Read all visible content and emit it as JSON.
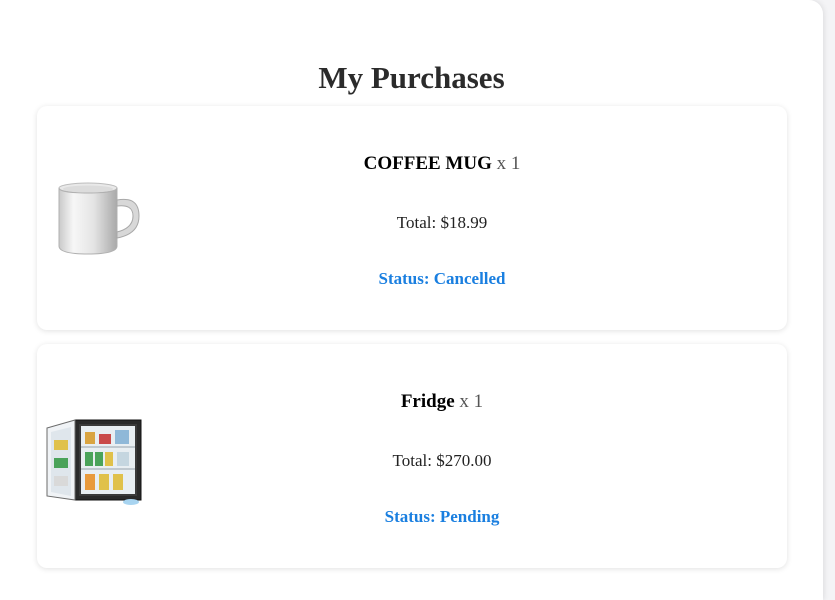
{
  "page": {
    "title": "My Purchases"
  },
  "purchases": [
    {
      "name": "COFFEE MUG",
      "qty": "x 1",
      "total": "Total: $18.99",
      "status": "Status: Cancelled",
      "image_icon": "coffee-mug-image"
    },
    {
      "name": "Fridge",
      "qty": "x 1",
      "total": "Total: $270.00",
      "status": "Status: Pending",
      "image_icon": "mini-fridge-image"
    }
  ],
  "colors": {
    "status": "#1a7fe0",
    "title": "#2b2b2b",
    "background": "#f4f4f6",
    "card": "#ffffff"
  }
}
